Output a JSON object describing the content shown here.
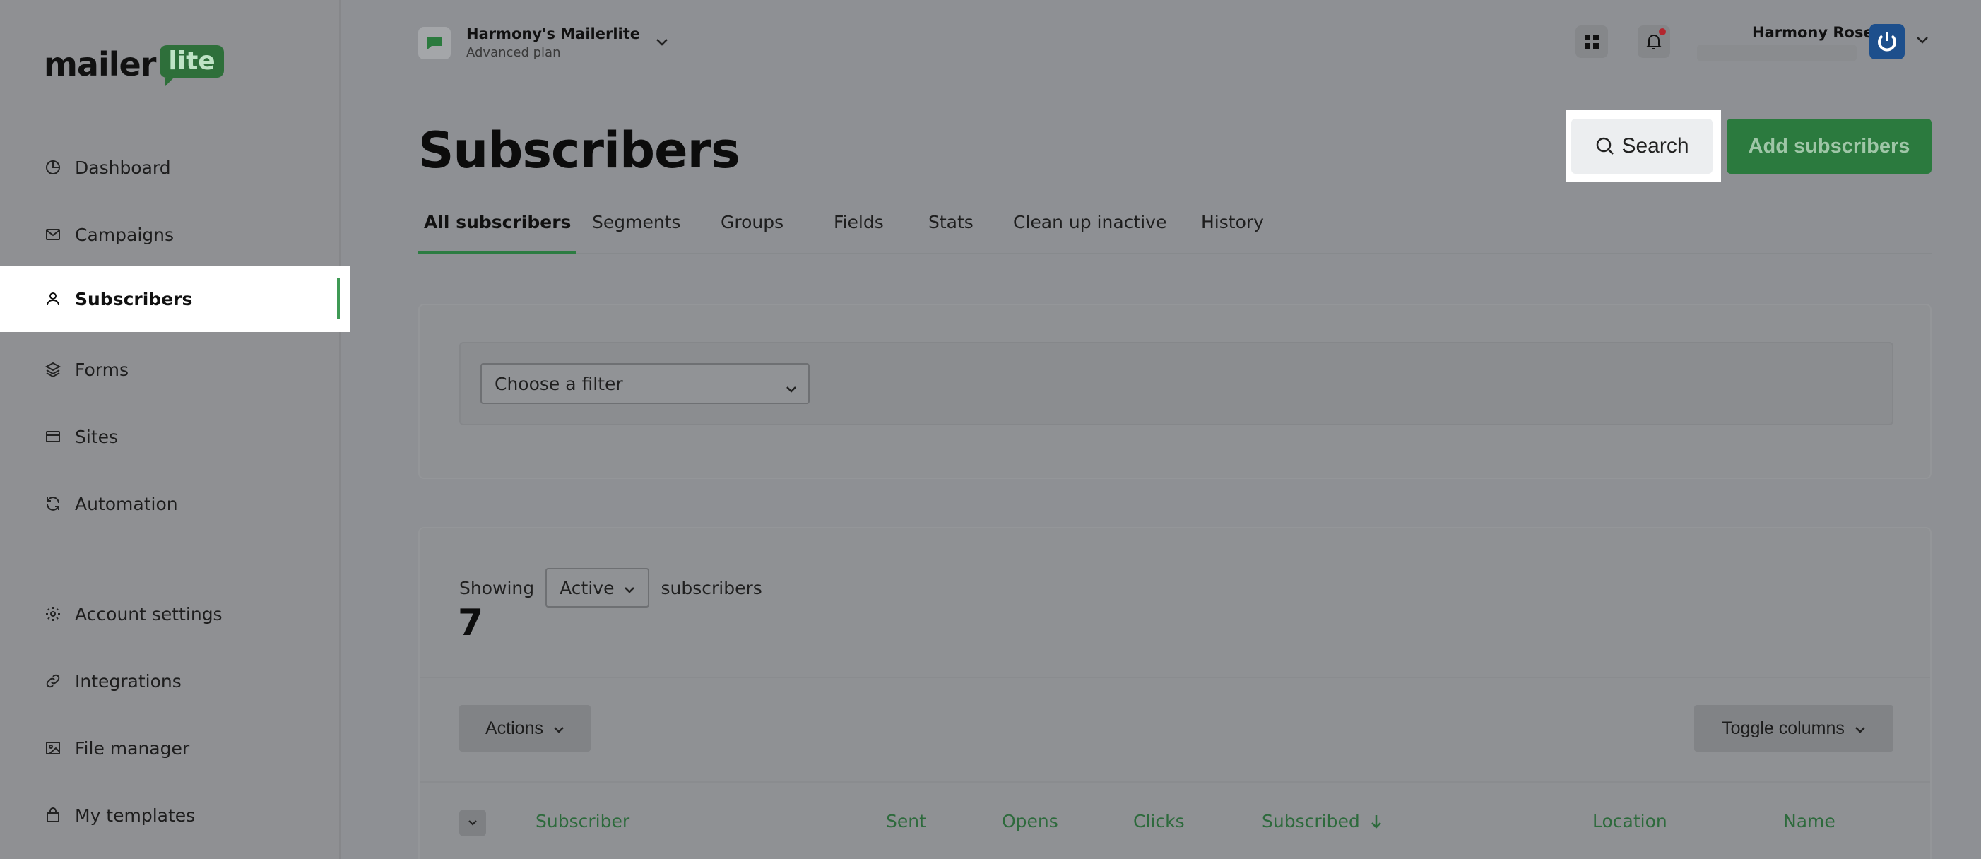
{
  "brand": {
    "word": "mailer",
    "badge": "lite"
  },
  "sidebar": {
    "items": [
      {
        "label": "Dashboard",
        "icon": "dashboard-icon"
      },
      {
        "label": "Campaigns",
        "icon": "mail-icon"
      },
      {
        "label": "Subscribers",
        "icon": "user-icon",
        "active": true
      },
      {
        "label": "Forms",
        "icon": "layers-icon"
      },
      {
        "label": "Sites",
        "icon": "browser-icon"
      },
      {
        "label": "Automation",
        "icon": "refresh-icon"
      },
      {
        "label": "Account settings",
        "icon": "gear-icon"
      },
      {
        "label": "Integrations",
        "icon": "link-icon"
      },
      {
        "label": "File manager",
        "icon": "image-icon"
      },
      {
        "label": "My templates",
        "icon": "template-icon"
      }
    ]
  },
  "workspace": {
    "name": "Harmony's Mailerlite",
    "plan": "Advanced plan"
  },
  "user": {
    "name": "Harmony Rose"
  },
  "page": {
    "title": "Subscribers"
  },
  "header": {
    "search_label": "Search",
    "add_label": "Add subscribers"
  },
  "tabs": [
    "All subscribers",
    "Segments",
    "Groups",
    "Fields",
    "Stats",
    "Clean up inactive",
    "History"
  ],
  "filter": {
    "placeholder": "Choose a filter"
  },
  "subscribers": {
    "showing_prefix": "Showing",
    "status": "Active",
    "showing_suffix": "subscribers",
    "count": "7",
    "actions_label": "Actions",
    "toggle_label": "Toggle columns",
    "columns": [
      "Subscriber",
      "Sent",
      "Opens",
      "Clicks",
      "Subscribed",
      "Location",
      "Name"
    ]
  },
  "colors": {
    "accent": "#2b7a3e",
    "active_tab": "#2c7c42",
    "notification": "#b3262e",
    "column_header": "#2d6a3c"
  }
}
